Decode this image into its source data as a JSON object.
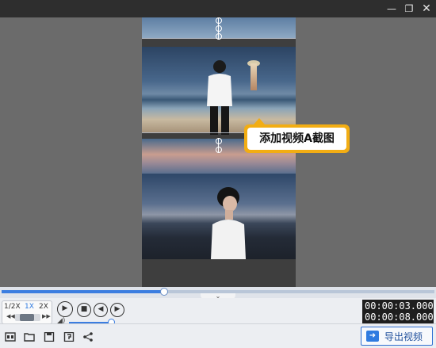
{
  "window": {
    "minimize_icon": "minimize-icon",
    "maximize_icon": "restore-icon",
    "close_icon": "close-icon"
  },
  "preview": {
    "callout_text": "添加视频A截图"
  },
  "player": {
    "progress_fraction": 0.375,
    "speed_options": [
      "1/2X",
      "1X",
      "2X"
    ],
    "speed_selected": "1X",
    "volume_fraction": 0.95,
    "current_time": "00:00:03.000",
    "total_time": "00:00:08.000"
  },
  "colors": {
    "accent": "#3b7de0",
    "callout": "#f2ad13",
    "titlebar": "#2e2e2e",
    "stage": "#6b6b6b"
  },
  "toolbar": {
    "icons": [
      "subtitle-icon",
      "open-folder-icon",
      "save-icon",
      "save-as-icon",
      "share-icon"
    ],
    "export_label": "导出视频"
  }
}
